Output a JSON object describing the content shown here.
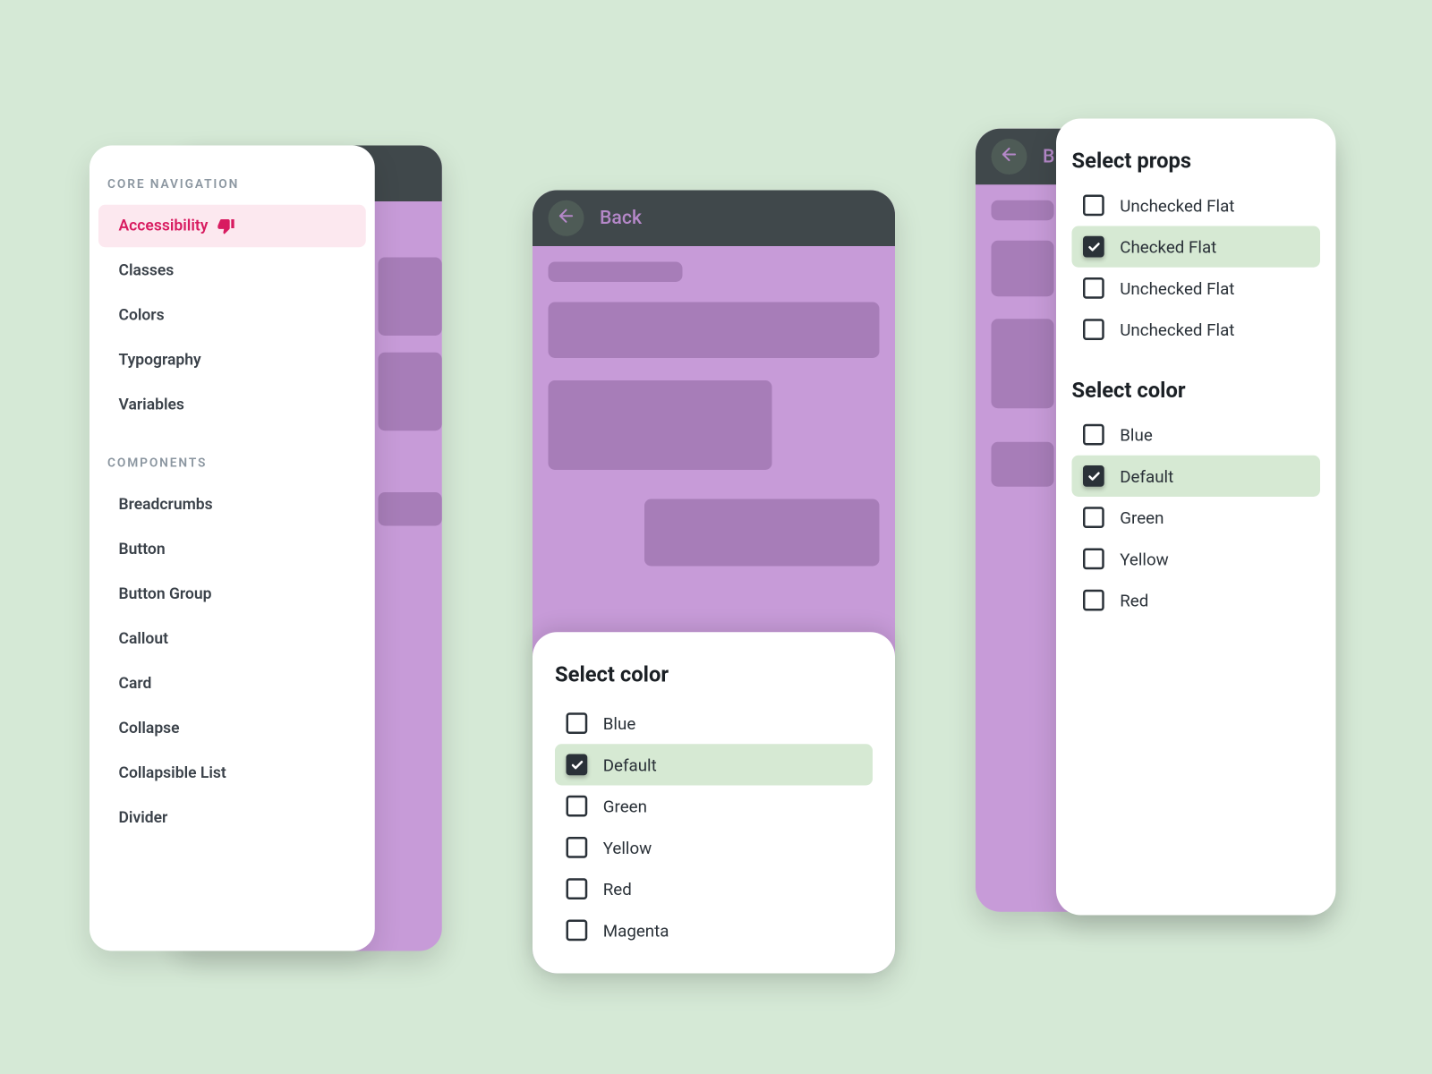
{
  "panel1": {
    "sections": [
      {
        "title": "CORE NAVIGATION",
        "items": [
          {
            "label": "Accessibility",
            "active": true,
            "icon": "thumb-down"
          },
          {
            "label": "Classes"
          },
          {
            "label": "Colors"
          },
          {
            "label": "Typography"
          },
          {
            "label": "Variables"
          }
        ]
      },
      {
        "title": "COMPONENTS",
        "items": [
          {
            "label": "Breadcrumbs"
          },
          {
            "label": "Button"
          },
          {
            "label": "Button Group"
          },
          {
            "label": "Callout"
          },
          {
            "label": "Card"
          },
          {
            "label": "Collapse"
          },
          {
            "label": "Collapsible List"
          },
          {
            "label": "Divider"
          }
        ]
      }
    ]
  },
  "panel2": {
    "back_label": "Back",
    "sheet_title": "Select color",
    "options": [
      {
        "label": "Blue",
        "checked": false
      },
      {
        "label": "Default",
        "checked": true
      },
      {
        "label": "Green",
        "checked": false
      },
      {
        "label": "Yellow",
        "checked": false
      },
      {
        "label": "Red",
        "checked": false
      },
      {
        "label": "Magenta",
        "checked": false
      }
    ]
  },
  "panel3": {
    "back_initial": "B",
    "groups": [
      {
        "title": "Select props",
        "options": [
          {
            "label": "Unchecked Flat",
            "checked": false
          },
          {
            "label": "Checked Flat",
            "checked": true
          },
          {
            "label": "Unchecked Flat",
            "checked": false
          },
          {
            "label": "Unchecked Flat",
            "checked": false
          }
        ]
      },
      {
        "title": "Select color",
        "options": [
          {
            "label": "Blue",
            "checked": false
          },
          {
            "label": "Default",
            "checked": true
          },
          {
            "label": "Green",
            "checked": false
          },
          {
            "label": "Yellow",
            "checked": false
          },
          {
            "label": "Red",
            "checked": false
          }
        ]
      }
    ]
  }
}
